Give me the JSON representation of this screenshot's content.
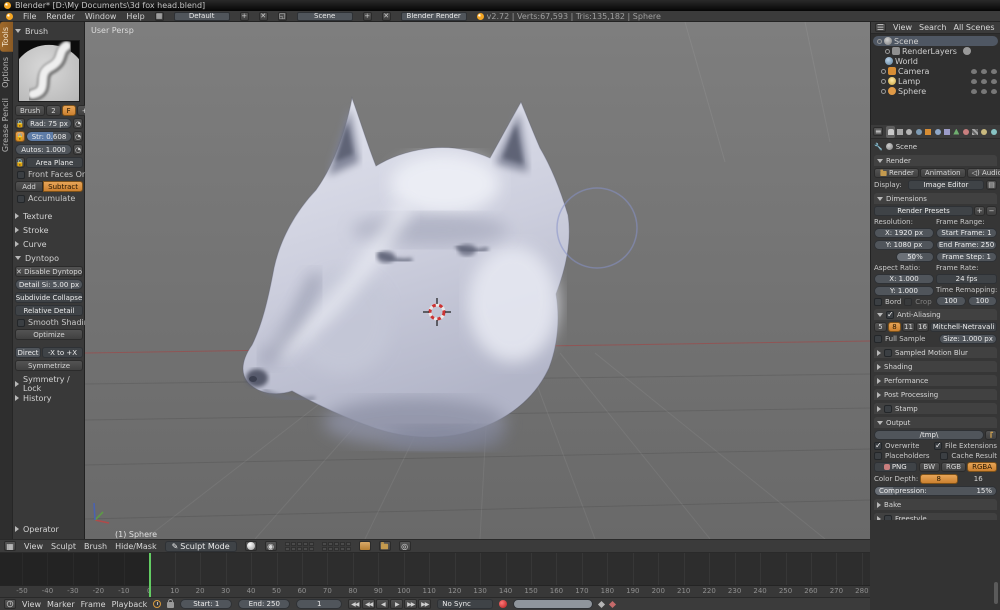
{
  "titlebar": {
    "title": "Blender* [D:\\My Documents\\3d fox head.blend]"
  },
  "menubar": {
    "menus": [
      "File",
      "Render",
      "Window",
      "Help"
    ],
    "layout_value": "Default",
    "scene_value": "Scene",
    "engine_value": "Blender Render",
    "stats": "v2.72 | Verts:67,593 | Tris:135,182 | Sphere"
  },
  "toolshelf": {
    "tabs": [
      {
        "label": "Tools"
      },
      {
        "label": "Options"
      },
      {
        "label": "Grease Pencil"
      }
    ],
    "brush": {
      "panel_title": "Brush",
      "name": "Brush",
      "users": "2",
      "fake_user": "F",
      "radius": "Rad: 75 px",
      "strength": "Str: 0.608",
      "autosmooth": "Autos: 1.000",
      "sculpt_plane": "Area Plane",
      "front_faces": "Front Faces Only",
      "add": "Add",
      "subtract": "Subtract",
      "accumulate": "Accumulate"
    },
    "collapsed_panels": [
      "Texture",
      "Stroke",
      "Curve"
    ],
    "dyntopo": {
      "title": "Dyntopo",
      "disable": "Disable Dyntopo",
      "detail_size": "Detail Si: 5.00 px",
      "method": "Subdivide Collapse",
      "detail_mode": "Relative Detail",
      "smooth_shading": "Smooth Shading",
      "optimize": "Optimize",
      "direction_label": "Direct",
      "direction_value": "-X to +X",
      "symmetrize": "Symmetrize"
    },
    "bottom_panels": [
      "Symmetry / Lock",
      "History"
    ],
    "operator_label": "Operator"
  },
  "viewport": {
    "view_label": "User Persp",
    "object_label": "(1) Sphere",
    "header": {
      "menus": [
        "View",
        "Sculpt",
        "Brush",
        "Hide/Mask"
      ],
      "mode_value": "Sculpt Mode"
    }
  },
  "outliner": {
    "header": {
      "menus": [
        "View",
        "Search"
      ],
      "filter": "All Scenes"
    },
    "items": [
      {
        "label": "Scene"
      },
      {
        "label": "RenderLayers"
      },
      {
        "label": "World"
      },
      {
        "label": "Camera"
      },
      {
        "label": "Lamp"
      },
      {
        "label": "Sphere"
      }
    ]
  },
  "properties": {
    "breadcrumb": "Scene",
    "render": {
      "title": "Render",
      "render_btn": "Render",
      "animation_btn": "Animation",
      "audio_btn": "Audio",
      "display_label": "Display:",
      "display_value": "Image Editor"
    },
    "dimensions": {
      "title": "Dimensions",
      "presets": "Render Presets",
      "resolution_label": "Resolution:",
      "res_x": "X: 1920 px",
      "res_y": "Y: 1080 px",
      "res_pct": "50%",
      "frame_range_label": "Frame Range:",
      "start_frame": "Start Frame: 1",
      "end_frame": "End Frame: 250",
      "frame_step": "Frame Step: 1",
      "aspect_label": "Aspect Ratio:",
      "aspect_x": "X: 1.000",
      "aspect_y": "Y: 1.000",
      "frame_rate_label": "Frame Rate:",
      "frame_rate": "24 fps",
      "border": "Bord",
      "crop": "Crop",
      "time_remap_label": "Time Remapping:",
      "remap_old": "100",
      "remap_new": "100"
    },
    "antialiasing": {
      "title": "Anti-Aliasing",
      "samples": [
        "5",
        "8",
        "11",
        "16"
      ],
      "filter": "Mitchell-Netravali",
      "full_sample": "Full Sample",
      "size": "Size:  1.000 px"
    },
    "collapsed": [
      {
        "label": "Sampled Motion Blur"
      },
      {
        "label": "Shading"
      },
      {
        "label": "Performance"
      },
      {
        "label": "Post Processing"
      },
      {
        "label": "Stamp"
      }
    ],
    "output": {
      "title": "Output",
      "path": "/tmp\\",
      "overwrite": "Overwrite",
      "file_extensions": "File Extensions",
      "placeholders": "Placeholders",
      "cache_result": "Cache Result",
      "format": "PNG",
      "bw": "BW",
      "rgb": "RGB",
      "rgba": "RGBA",
      "color_depth_label": "Color Depth:",
      "depth8": "8",
      "depth16": "16",
      "compression_label": "Compression:",
      "compression_value": "15%"
    },
    "bottom_collapsed": [
      {
        "label": "Bake"
      },
      {
        "label": "Freestyle"
      }
    ]
  },
  "timeline": {
    "menus": [
      "View",
      "Marker",
      "Frame",
      "Playback"
    ],
    "start_label": "Start:",
    "start_value": "1",
    "end_label": "End:",
    "end_value": "250",
    "current_frame": "1",
    "sync_value": "No Sync",
    "ticks": [
      -50,
      -40,
      -30,
      -20,
      -10,
      0,
      10,
      20,
      30,
      40,
      50,
      60,
      70,
      80,
      90,
      100,
      110,
      120,
      130,
      140,
      150,
      160,
      170,
      180,
      190,
      200,
      210,
      220,
      230,
      240,
      250,
      260,
      270,
      280
    ]
  },
  "colors": {
    "accent_orange": "#cc8130",
    "slider_blue": "#5d7ba6",
    "playhead_green": "#63cc63",
    "viewport_gray": "#707070"
  }
}
